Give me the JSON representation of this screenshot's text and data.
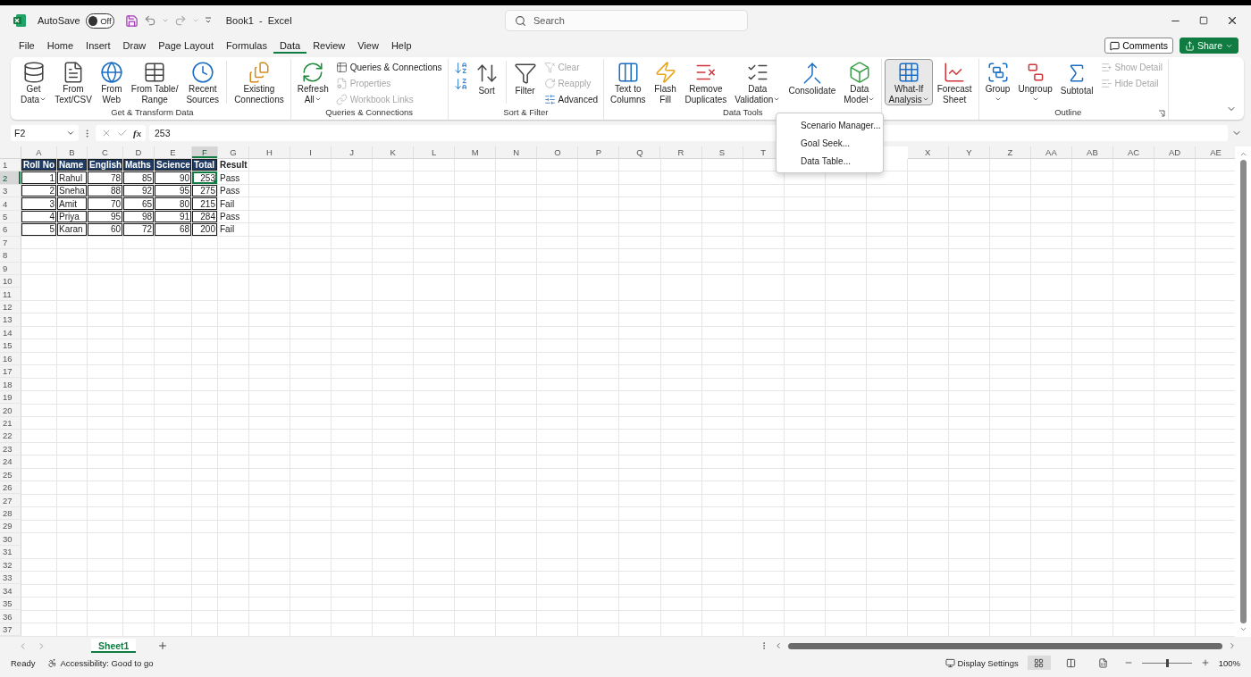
{
  "title_bar": {
    "autosave_label": "AutoSave",
    "autosave_state": "Off",
    "autosave_on": false,
    "title": "Book1  -  Excel",
    "search_placeholder": "Search"
  },
  "menu_tabs": [
    {
      "label": "File",
      "selected": false
    },
    {
      "label": "Home",
      "selected": false
    },
    {
      "label": "Insert",
      "selected": false
    },
    {
      "label": "Draw",
      "selected": false
    },
    {
      "label": "Page Layout",
      "selected": false
    },
    {
      "label": "Formulas",
      "selected": false
    },
    {
      "label": "Data",
      "selected": true
    },
    {
      "label": "Review",
      "selected": false
    },
    {
      "label": "View",
      "selected": false
    },
    {
      "label": "Help",
      "selected": false
    }
  ],
  "comments_button": "Comments",
  "share_button": "Share",
  "ribbon_groups": [
    {
      "label": "Get & Transform Data",
      "launcher": false,
      "items": [
        {
          "kind": "large",
          "lines": [
            "Get",
            "Data"
          ],
          "dropdown": true,
          "pressed": false
        },
        {
          "kind": "large",
          "lines": [
            "From",
            "Text/CSV"
          ],
          "dropdown": false,
          "pressed": false
        },
        {
          "kind": "large",
          "lines": [
            "From",
            "Web"
          ],
          "dropdown": false,
          "pressed": false
        },
        {
          "kind": "large",
          "lines": [
            "From Table/",
            "Range"
          ],
          "dropdown": false,
          "pressed": false
        },
        {
          "kind": "large",
          "lines": [
            "Recent",
            "Sources"
          ],
          "dropdown": false,
          "pressed": false
        },
        {
          "kind": "separator"
        },
        {
          "kind": "large",
          "lines": [
            "Existing",
            "Connections"
          ],
          "dropdown": false,
          "pressed": false
        }
      ]
    },
    {
      "label": "Queries & Connections",
      "launcher": false,
      "items": [
        {
          "kind": "large",
          "lines": [
            "Refresh",
            "All"
          ],
          "dropdown": true,
          "pressed": false
        },
        {
          "kind": "stack",
          "items": [
            {
              "label": "Queries & Connections",
              "disabled": false
            },
            {
              "label": "Properties",
              "disabled": true
            },
            {
              "label": "Workbook Links",
              "disabled": true
            }
          ]
        }
      ]
    },
    {
      "label": "Sort & Filter",
      "launcher": false,
      "items": [
        {
          "kind": "stack",
          "items": [
            {
              "disabled": false
            },
            {
              "disabled": false
            }
          ]
        },
        {
          "kind": "large",
          "lines": [
            "Sort"
          ],
          "dropdown": false,
          "pressed": false
        },
        {
          "kind": "separator"
        },
        {
          "kind": "large",
          "lines": [
            "Filter"
          ],
          "dropdown": false,
          "pressed": false
        },
        {
          "kind": "stack",
          "items": [
            {
              "label": "Clear",
              "disabled": true
            },
            {
              "label": "Reapply",
              "disabled": true
            },
            {
              "label": "Advanced",
              "disabled": false
            }
          ]
        }
      ]
    },
    {
      "label": "Data Tools",
      "launcher": false,
      "items": [
        {
          "kind": "large",
          "lines": [
            "Text to",
            "Columns"
          ],
          "dropdown": false,
          "pressed": false
        },
        {
          "kind": "large",
          "lines": [
            "Flash",
            "Fill"
          ],
          "dropdown": false,
          "pressed": false
        },
        {
          "kind": "large",
          "lines": [
            "Remove",
            "Duplicates"
          ],
          "dropdown": false,
          "pressed": false
        },
        {
          "kind": "large",
          "lines": [
            "Data",
            "Validation"
          ],
          "dropdown": true,
          "pressed": false
        },
        {
          "kind": "large",
          "lines": [
            "Consolidate"
          ],
          "dropdown": false,
          "pressed": false
        },
        {
          "kind": "large",
          "lines": [
            "Data",
            "Model"
          ],
          "dropdown": true,
          "pressed": false
        }
      ]
    },
    {
      "items": [
        {
          "kind": "large",
          "lines": [
            "What-If",
            "Analysis"
          ],
          "dropdown": true,
          "pressed": true
        },
        {
          "kind": "large",
          "lines": [
            "Forecast",
            "Sheet"
          ],
          "dropdown": false,
          "pressed": false
        }
      ]
    },
    {
      "label": "Outline",
      "launcher": true,
      "items": [
        {
          "kind": "large",
          "lines": [
            "Group"
          ],
          "dropdown": true,
          "pressed": false
        },
        {
          "kind": "large",
          "lines": [
            "Ungroup"
          ],
          "dropdown": true,
          "pressed": false
        },
        {
          "kind": "large",
          "lines": [
            "Subtotal"
          ],
          "dropdown": false,
          "pressed": false
        },
        {
          "kind": "stack",
          "items": [
            {
              "label": "Show Detail",
              "disabled": true
            },
            {
              "label": "Hide Detail",
              "disabled": true
            }
          ]
        }
      ]
    }
  ],
  "what_if_menu": [
    "Scenario Manager...",
    "Goal Seek...",
    "Data Table..."
  ],
  "formula_bar": {
    "name_box": "F2",
    "function_label": "fx",
    "formula": "253"
  },
  "sheet": {
    "columns": [
      {
        "label": "A",
        "selected": false
      },
      {
        "label": "B",
        "selected": false
      },
      {
        "label": "C",
        "selected": false
      },
      {
        "label": "D",
        "selected": false
      },
      {
        "label": "E",
        "selected": false
      },
      {
        "label": "F",
        "selected": true
      },
      {
        "label": "G",
        "selected": false
      },
      {
        "label": "H",
        "selected": false
      },
      {
        "label": "I",
        "selected": false
      },
      {
        "label": "J",
        "selected": false
      },
      {
        "label": "K",
        "selected": false
      },
      {
        "label": "L",
        "selected": false
      },
      {
        "label": "M",
        "selected": false
      },
      {
        "label": "N",
        "selected": false
      },
      {
        "label": "O",
        "selected": false
      },
      {
        "label": "P",
        "selected": false
      },
      {
        "label": "Q",
        "selected": false
      },
      {
        "label": "R",
        "selected": false
      },
      {
        "label": "S",
        "selected": false
      },
      {
        "label": "T",
        "selected": false
      },
      {},
      {},
      {},
      {
        "label": "X",
        "selected": false
      },
      {
        "label": "Y",
        "selected": false
      },
      {
        "label": "Z",
        "selected": false
      },
      {
        "label": "AA",
        "selected": false
      },
      {
        "label": "AB",
        "selected": false
      },
      {
        "label": "AC",
        "selected": false
      },
      {
        "label": "AD",
        "selected": false
      },
      {
        "label": "AE",
        "selected": false
      }
    ],
    "rows": [
      {
        "label": "1",
        "selected": false,
        "cells": [
          {
            "kind": "head",
            "text": "Roll No",
            "selected": false
          },
          {
            "kind": "head",
            "text": "Name",
            "selected": false
          },
          {
            "kind": "head",
            "text": "English",
            "selected": false
          },
          {
            "kind": "head",
            "text": "Maths",
            "selected": false
          },
          {
            "kind": "head",
            "text": "Science",
            "selected": false
          },
          {
            "kind": "head",
            "text": "Total",
            "selected": false
          },
          {
            "kind": "label",
            "text": "Result",
            "selected": false
          }
        ]
      },
      {
        "label": "2",
        "selected": true,
        "cells": [
          {
            "kind": "num",
            "text": "1",
            "selected": false
          },
          {
            "kind": "text",
            "text": "Rahul",
            "selected": false
          },
          {
            "kind": "num",
            "text": "78",
            "selected": false
          },
          {
            "kind": "num",
            "text": "85",
            "selected": false
          },
          {
            "kind": "num",
            "text": "90",
            "selected": false
          },
          {
            "kind": "num",
            "text": "253",
            "selected": true
          },
          {
            "kind": "plain",
            "text": "Pass",
            "selected": false
          }
        ]
      },
      {
        "label": "3",
        "selected": false,
        "cells": [
          {
            "kind": "num",
            "text": "2",
            "selected": false
          },
          {
            "kind": "text",
            "text": "Sneha",
            "selected": false
          },
          {
            "kind": "num",
            "text": "88",
            "selected": false
          },
          {
            "kind": "num",
            "text": "92",
            "selected": false
          },
          {
            "kind": "num",
            "text": "95",
            "selected": false
          },
          {
            "kind": "num",
            "text": "275",
            "selected": false
          },
          {
            "kind": "plain",
            "text": "Pass",
            "selected": false
          }
        ]
      },
      {
        "label": "4",
        "selected": false,
        "cells": [
          {
            "kind": "num",
            "text": "3",
            "selected": false
          },
          {
            "kind": "text",
            "text": "Amit",
            "selected": false
          },
          {
            "kind": "num",
            "text": "70",
            "selected": false
          },
          {
            "kind": "num",
            "text": "65",
            "selected": false
          },
          {
            "kind": "num",
            "text": "80",
            "selected": false
          },
          {
            "kind": "num",
            "text": "215",
            "selected": false
          },
          {
            "kind": "plain",
            "text": "Fail",
            "selected": false
          }
        ]
      },
      {
        "label": "5",
        "selected": false,
        "cells": [
          {
            "kind": "num",
            "text": "4",
            "selected": false
          },
          {
            "kind": "text",
            "text": "Priya",
            "selected": false
          },
          {
            "kind": "num",
            "text": "95",
            "selected": false
          },
          {
            "kind": "num",
            "text": "98",
            "selected": false
          },
          {
            "kind": "num",
            "text": "91",
            "selected": false
          },
          {
            "kind": "num",
            "text": "284",
            "selected": false
          },
          {
            "kind": "plain",
            "text": "Pass",
            "selected": false
          }
        ]
      },
      {
        "label": "6",
        "selected": false,
        "cells": [
          {
            "kind": "num",
            "text": "5",
            "selected": false
          },
          {
            "kind": "text",
            "text": "Karan",
            "selected": false
          },
          {
            "kind": "num",
            "text": "60",
            "selected": false
          },
          {
            "kind": "num",
            "text": "72",
            "selected": false
          },
          {
            "kind": "num",
            "text": "68",
            "selected": false
          },
          {
            "kind": "num",
            "text": "200",
            "selected": false
          },
          {
            "kind": "plain",
            "text": "Fail",
            "selected": false
          }
        ]
      },
      {
        "label": "7",
        "selected": false
      },
      {
        "label": "8",
        "selected": false
      },
      {
        "label": "9",
        "selected": false
      },
      {
        "label": "10",
        "selected": false
      },
      {
        "label": "11",
        "selected": false
      },
      {
        "label": "12",
        "selected": false
      },
      {
        "label": "13",
        "selected": false
      },
      {
        "label": "14",
        "selected": false
      },
      {
        "label": "15",
        "selected": false
      },
      {
        "label": "16",
        "selected": false
      },
      {
        "label": "17",
        "selected": false
      },
      {
        "label": "18",
        "selected": false
      },
      {
        "label": "19",
        "selected": false
      },
      {
        "label": "20",
        "selected": false
      },
      {
        "label": "21",
        "selected": false
      },
      {
        "label": "22",
        "selected": false
      },
      {
        "label": "23",
        "selected": false
      },
      {
        "label": "24",
        "selected": false
      },
      {
        "label": "25",
        "selected": false
      },
      {
        "label": "26",
        "selected": false
      },
      {
        "label": "27",
        "selected": false
      },
      {
        "label": "28",
        "selected": false
      },
      {
        "label": "29",
        "selected": false
      },
      {
        "label": "30",
        "selected": false
      },
      {
        "label": "31",
        "selected": false
      },
      {
        "label": "32",
        "selected": false
      },
      {
        "label": "33",
        "selected": false
      },
      {
        "label": "34",
        "selected": false
      },
      {
        "label": "35",
        "selected": false
      },
      {
        "label": "36",
        "selected": false
      },
      {
        "label": "37",
        "selected": false
      }
    ]
  },
  "sheet_tabs": [
    {
      "label": "Sheet1",
      "selected": true
    }
  ],
  "status_bar": {
    "ready": "Ready",
    "accessibility": "Accessibility: Good to go",
    "display_settings": "Display Settings",
    "view_buttons": [
      {
        "selected": true
      },
      {
        "selected": false
      },
      {
        "selected": false
      }
    ],
    "zoom": {
      "level": 0.5,
      "reading": "100%"
    }
  }
}
